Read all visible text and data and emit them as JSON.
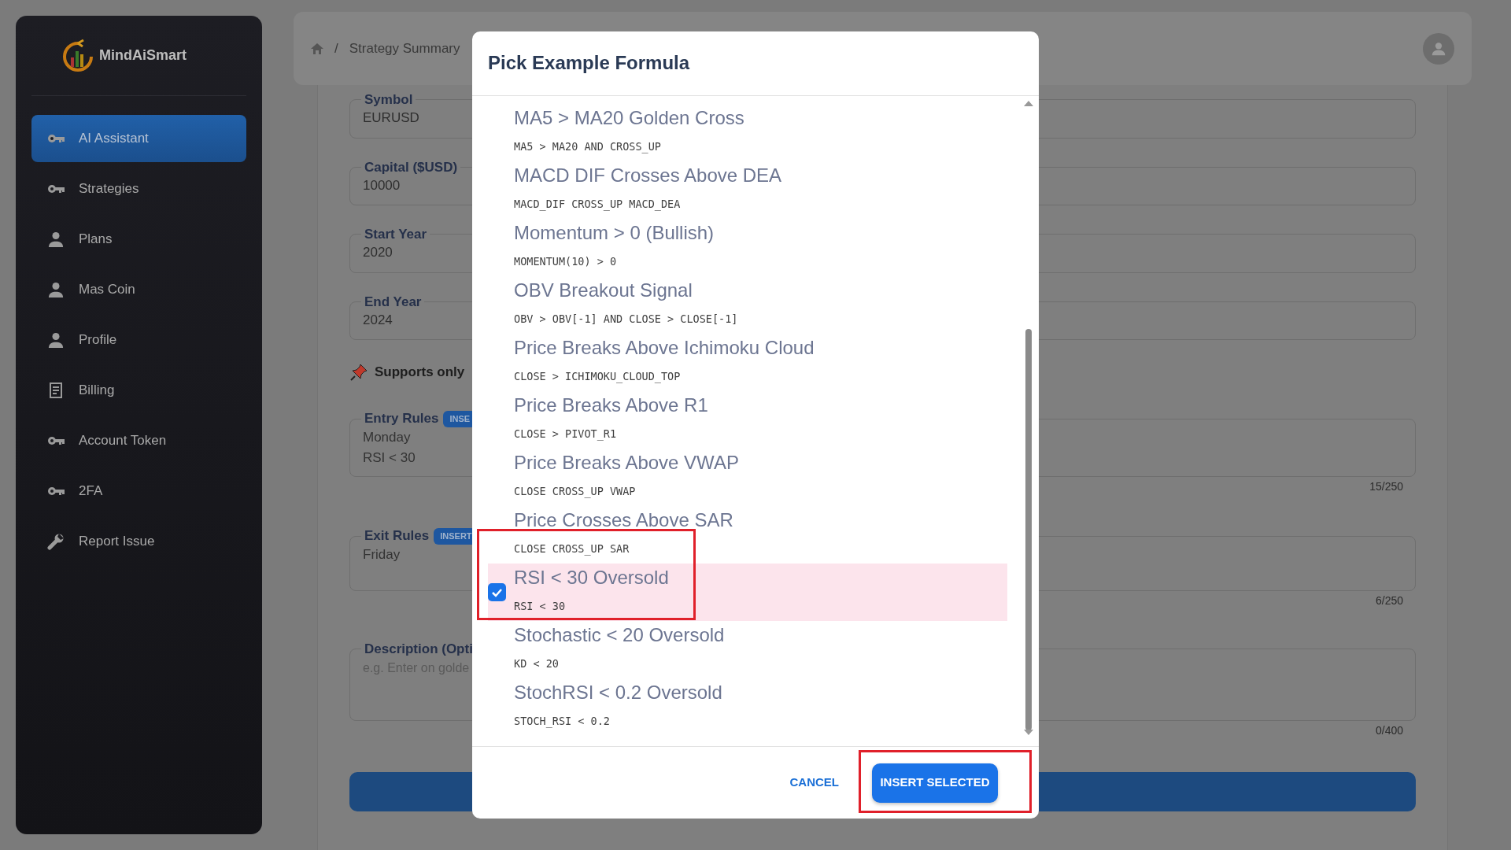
{
  "sidebar": {
    "brand": "MindAiSmart",
    "items": [
      {
        "label": "AI Assistant",
        "kind": "key",
        "selected": true
      },
      {
        "label": "Strategies",
        "kind": "key",
        "selected": false
      },
      {
        "label": "Plans",
        "kind": "person",
        "selected": false
      },
      {
        "label": "Mas Coin",
        "kind": "person",
        "selected": false
      },
      {
        "label": "Profile",
        "kind": "person",
        "selected": false
      },
      {
        "label": "Billing",
        "kind": "receipt",
        "selected": false
      },
      {
        "label": "Account Token",
        "kind": "key",
        "selected": false
      },
      {
        "label": "2FA",
        "kind": "key",
        "selected": false
      },
      {
        "label": "Report Issue",
        "kind": "wrench",
        "selected": false
      }
    ]
  },
  "breadcrumb": {
    "separator": "/",
    "current": "Strategy Summary"
  },
  "form": {
    "fields": [
      {
        "label": "Symbol",
        "value": "EURUSD"
      },
      {
        "label": "Capital ($USD)",
        "value": "10000"
      },
      {
        "label": "Start Year",
        "value": "2020"
      },
      {
        "label": "End Year",
        "value": "2024"
      }
    ],
    "notice": "Supports only",
    "rules": [
      {
        "label": "Entry Rules",
        "button": "INSE",
        "lines": [
          "Monday",
          "RSI < 30"
        ],
        "counter": "15/250"
      },
      {
        "label": "Exit Rules",
        "button": "INSERT",
        "lines": [
          "Friday"
        ],
        "counter": "6/250"
      }
    ],
    "description": {
      "label": "Description (Opti",
      "placeholder": "e.g. Enter on golde",
      "counter": "0/400"
    }
  },
  "dialog": {
    "title": "Pick Example Formula",
    "items": [
      {
        "name": "MA5 > MA20 Golden Cross",
        "formula": "MA5 > MA20 AND CROSS_UP",
        "selected": false
      },
      {
        "name": "MACD DIF Crosses Above DEA",
        "formula": "MACD_DIF CROSS_UP MACD_DEA",
        "selected": false
      },
      {
        "name": "Momentum > 0 (Bullish)",
        "formula": "MOMENTUM(10) > 0",
        "selected": false
      },
      {
        "name": "OBV Breakout Signal",
        "formula": "OBV > OBV[-1] AND CLOSE > CLOSE[-1]",
        "selected": false
      },
      {
        "name": "Price Breaks Above Ichimoku Cloud",
        "formula": "CLOSE > ICHIMOKU_CLOUD_TOP",
        "selected": false
      },
      {
        "name": "Price Breaks Above R1",
        "formula": "CLOSE > PIVOT_R1",
        "selected": false
      },
      {
        "name": "Price Breaks Above VWAP",
        "formula": "CLOSE CROSS_UP VWAP",
        "selected": false
      },
      {
        "name": "Price Crosses Above SAR",
        "formula": "CLOSE CROSS_UP SAR",
        "selected": false
      },
      {
        "name": "RSI < 30 Oversold",
        "formula": "RSI < 30",
        "selected": true
      },
      {
        "name": "Stochastic < 20 Oversold",
        "formula": "KD < 20",
        "selected": false
      },
      {
        "name": "StochRSI < 0.2 Oversold",
        "formula": "STOCH_RSI < 0.2",
        "selected": false
      }
    ],
    "cancel": "CANCEL",
    "confirm": "INSERT SELECTED"
  }
}
